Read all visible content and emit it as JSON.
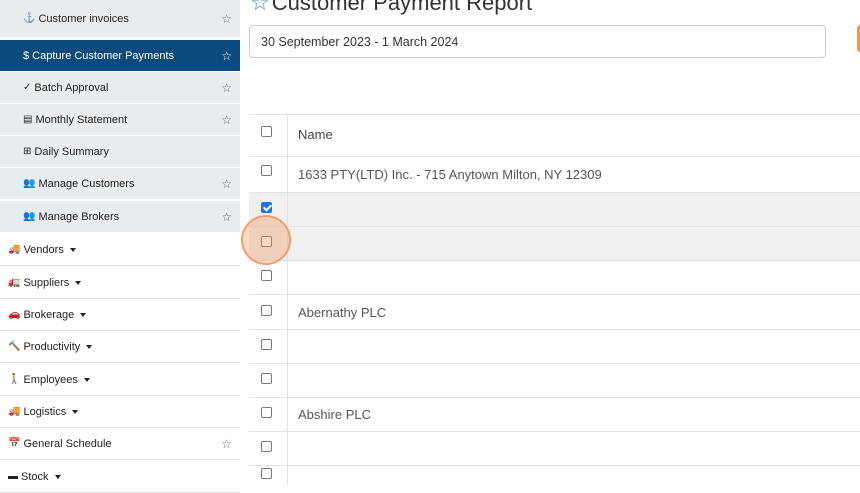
{
  "sidebar": {
    "sub_items": [
      {
        "label": "Customer invoices",
        "icon": "⚓",
        "icon_name": "download-icon",
        "starred": true
      },
      {
        "label": "$ Capture Customer Payments",
        "icon": "",
        "icon_name": "",
        "starred": true,
        "active": true
      },
      {
        "label": "Batch Approval",
        "icon": "✓",
        "icon_name": "check-icon",
        "starred": true
      },
      {
        "label": "Monthly Statement",
        "icon": "▤",
        "icon_name": "statement-icon",
        "starred": true
      },
      {
        "label": "Daily Summary",
        "icon": "⊞",
        "icon_name": "table-icon",
        "starred": false
      },
      {
        "label": "Manage Customers",
        "icon": "👥",
        "icon_name": "users-icon",
        "starred": true
      },
      {
        "label": "Manage Brokers",
        "icon": "👥",
        "icon_name": "users-icon",
        "starred": true
      }
    ],
    "top_items": [
      {
        "label": "Vendors",
        "icon": "🚚",
        "icon_name": "truck-icon",
        "caret": true
      },
      {
        "label": "Suppliers",
        "icon": "🚛",
        "icon_name": "truck-icon",
        "caret": true
      },
      {
        "label": "Brokerage",
        "icon": "🚗",
        "icon_name": "car-icon",
        "caret": true
      },
      {
        "label": "Productivity",
        "icon": "🔨",
        "icon_name": "hammer-icon",
        "caret": true
      },
      {
        "label": "Employees",
        "icon": "🚶",
        "icon_name": "person-icon",
        "caret": true
      },
      {
        "label": "Logistics",
        "icon": "🚚",
        "icon_name": "truck-icon",
        "caret": true
      },
      {
        "label": "General Schedule",
        "icon": "📅",
        "icon_name": "calendar-icon",
        "caret": false,
        "starred": true
      },
      {
        "label": "Stock",
        "icon": "▬",
        "icon_name": "stock-icon",
        "caret": true
      }
    ]
  },
  "main": {
    "title": "Customer Payment Report",
    "date_range": "30 September 2023 - 1 March 2024"
  },
  "table": {
    "header": "Name",
    "rows": [
      {
        "name": "1633 PTY(LTD) Inc. - 715 Anytown Milton, NY 12309",
        "checked": false,
        "highlight": false
      },
      {
        "name": "",
        "checked": true,
        "highlight": true
      },
      {
        "name": "",
        "checked": false,
        "highlight": true
      },
      {
        "name": "",
        "checked": false,
        "highlight": false
      },
      {
        "name": "Abernathy PLC",
        "checked": false,
        "highlight": false
      },
      {
        "name": "",
        "checked": false,
        "highlight": false
      },
      {
        "name": "",
        "checked": false,
        "highlight": false
      },
      {
        "name": "Abshire PLC",
        "checked": false,
        "highlight": false
      },
      {
        "name": "",
        "checked": false,
        "highlight": false
      },
      {
        "name": "",
        "checked": false,
        "highlight": false
      }
    ]
  },
  "colors": {
    "active_bg": "#0b4a7d",
    "sub_bg": "#e9ecef",
    "accent": "#1a73e8",
    "click_ring": "#f0965a"
  }
}
